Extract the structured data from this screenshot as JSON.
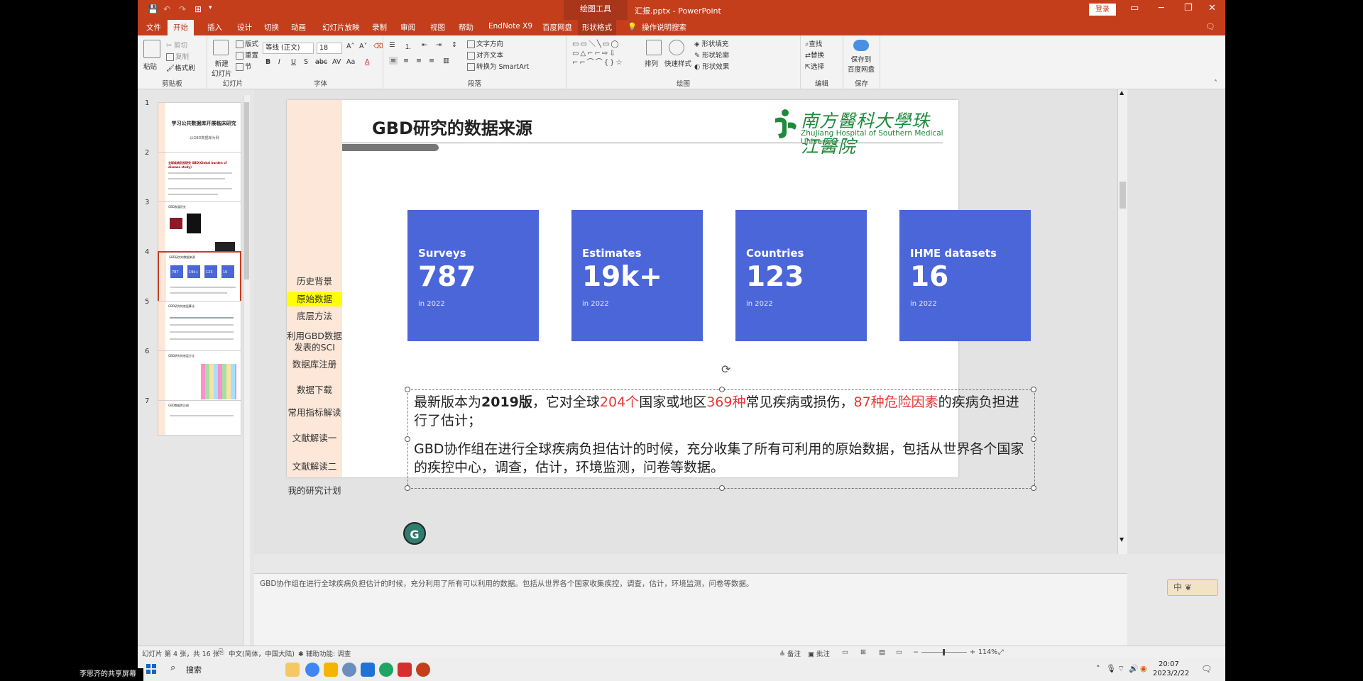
{
  "titlebar": {
    "context_tab": "绘图工具",
    "doc_title": "汇报.pptx - PowerPoint",
    "login": "登录",
    "icons": [
      "save-icon",
      "undo-icon",
      "redo-icon",
      "start-from-beginning-icon",
      "customize-icon"
    ]
  },
  "tabs": [
    "文件",
    "开始",
    "插入",
    "设计",
    "切换",
    "动画",
    "幻灯片放映",
    "录制",
    "审阅",
    "视图",
    "帮助",
    "EndNote X9",
    "百度网盘",
    "形状格式",
    "操作说明搜索"
  ],
  "ribbon": {
    "clipboard": {
      "paste": "粘贴",
      "cut": "剪切",
      "copy": "复制",
      "format_painter": "格式刷",
      "label": "剪贴板"
    },
    "slides": {
      "new_slide": "新建\n幻灯片",
      "layout": "版式",
      "reset": "重置",
      "section": "节",
      "label": "幻灯片"
    },
    "font": {
      "font_name": "等线 (正文)",
      "font_size": "18",
      "label": "字体"
    },
    "paragraph": {
      "text_direction": "文字方向",
      "align_text": "对齐文本",
      "smartart": "转换为 SmartArt",
      "label": "段落"
    },
    "drawing": {
      "arrange": "排列",
      "quick_styles": "快速样式",
      "shape_fill": "形状填充",
      "shape_outline": "形状轮廓",
      "shape_effects": "形状效果",
      "label": "绘图"
    },
    "editing": {
      "find": "查找",
      "replace": "替换",
      "select": "选择",
      "label": "编辑"
    },
    "save": {
      "btn": "保存到\n百度网盘",
      "label": "保存"
    }
  },
  "thumbnails": [
    {
      "num": "1",
      "title": "学习公共数据库开展临床研究",
      "sub": "-以GBD数据库为例"
    },
    {
      "num": "2",
      "title": "全球疾病负担研究 GBD(Global burden of disease study)"
    },
    {
      "num": "3",
      "title": "GBD发展历史"
    },
    {
      "num": "4",
      "title": "GBD研究的数据来源",
      "vals": [
        "787",
        "19k+",
        "123",
        "16"
      ]
    },
    {
      "num": "5",
      "title": "GBD研究的底层算法"
    },
    {
      "num": "6",
      "title": "GBD研究的底层方法"
    },
    {
      "num": "7",
      "title": "GBD数据库注册"
    }
  ],
  "slide": {
    "title": "GBD研究的数据来源",
    "logo_cn": "南方醫科大學珠江醫院",
    "logo_en": "ZhuJiang Hospital of Southern Medical University",
    "nav": [
      "历史背景",
      "原始数据",
      "底层方法",
      "利用GBD数据发表的SCI",
      "数据库注册",
      "数据下载",
      "常用指标解读",
      "文献解读一",
      "文献解读二",
      "我的研究计划"
    ],
    "nav_active": "原始数据",
    "cards": [
      {
        "label": "Surveys",
        "value": "787",
        "sub": "in 2022"
      },
      {
        "label": "Estimates",
        "value": "19k+",
        "sub": "in 2022"
      },
      {
        "label": "Countries",
        "value": "123",
        "sub": "in 2022"
      },
      {
        "label": "IHME datasets",
        "value": "16",
        "sub": "in 2022"
      }
    ],
    "p1": {
      "a": "最新版本为",
      "b": "2019版",
      "c": "，它对全球",
      "d": "204个",
      "e": "国家或地区",
      "f": "369种",
      "g": "常见疾病或损伤，",
      "h": "87种危险因素",
      "i": "的疾病负担进行了估计；"
    },
    "p2": "GBD协作组在进行全球疾病负担估计的时候，充分收集了所有可利用的原始数据，包括从世界各个国家的疾控中心，调查，估计，环境监测，问卷等数据。"
  },
  "notes": "GBD协作组在进行全球疾病负担估计的时候，充分利用了所有可以利用的数据。包括从世界各个国家收集疾控，调查，估计，环境监测，问卷等数据。",
  "ime": "中 ❦",
  "status": {
    "slide_info": "幻灯片 第 4 张，共 16 张",
    "lang": "中文(简体，中国大陆)",
    "accessibility": "辅助功能: 调查",
    "notes_btn": "备注",
    "comments_btn": "批注",
    "zoom": "114%"
  },
  "taskbar": {
    "search": "搜索",
    "time": "20:07",
    "date": "2023/2/22",
    "share_label": "李思齐的共享屏幕"
  },
  "colors": {
    "accent": "#c43e1c",
    "card": "#4a66d8",
    "highlight": "#ffff00",
    "red": "#e53935",
    "logo_green": "#1e8a3c"
  }
}
